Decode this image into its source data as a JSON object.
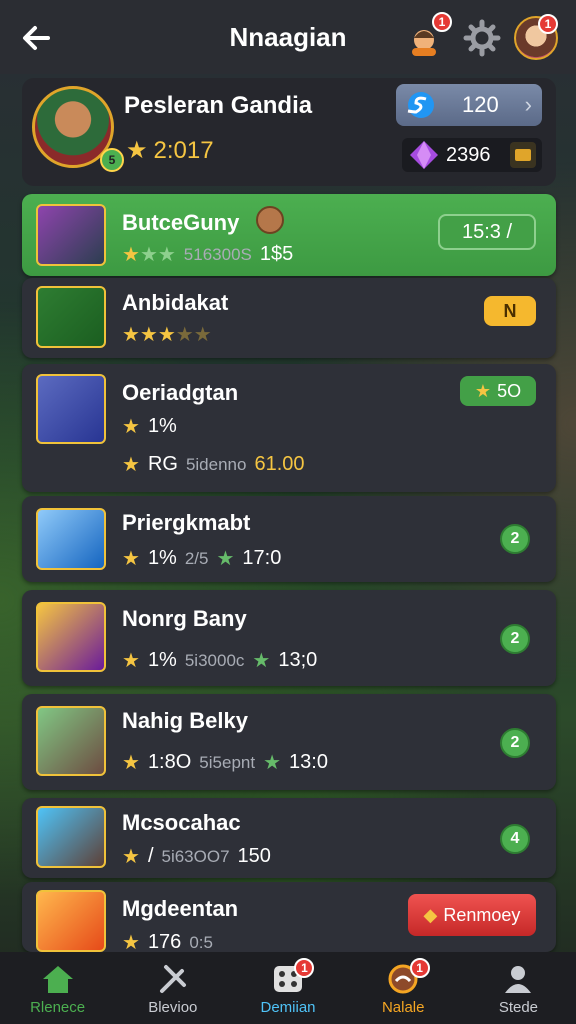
{
  "header": {
    "title": "Nnaagian",
    "notif_count_1": "1",
    "notif_count_2": "1"
  },
  "profile": {
    "name": "Pesleran Gandia",
    "score": "2:017",
    "coins": "120",
    "gems": "2396",
    "avatar_badge": "5"
  },
  "rows": [
    {
      "name": "ButceGuny",
      "stat": "516300S",
      "count": "1$5",
      "action": "15:3 /"
    },
    {
      "name": "Anbidakat",
      "action": "N"
    },
    {
      "name": "Oeriadgtan",
      "stars_text": "1%",
      "rating": "RG",
      "stat": "5idenno",
      "points": "61.00",
      "action": "5O"
    },
    {
      "name": "Priergkmabt",
      "stars_text": "1%",
      "stat": "2/5",
      "points": "17:0",
      "action": "2"
    },
    {
      "name": "Nonrg Bany",
      "stars_text": "1%",
      "stat": "5i3000c",
      "points": "13;0",
      "action": "2"
    },
    {
      "name": "Nahig Belky",
      "stars_text": "1:8O",
      "stat": "5i5epnt",
      "points": "13:0",
      "action": "2"
    },
    {
      "name": "Mcsocahac",
      "stars_text": "/",
      "stat": "5i63OO7",
      "points": "150",
      "action": "4"
    },
    {
      "name": "Mgdeentan",
      "stars_text": "176",
      "stat": "0:5",
      "action": "Renmoey"
    }
  ],
  "nav": [
    {
      "label": "Rlenece",
      "color": "#4caf50"
    },
    {
      "label": "Blevioo",
      "color": "#c9ccd2"
    },
    {
      "label": "Demiian",
      "color": "#4fc3f7",
      "badge": "1"
    },
    {
      "label": "Nalale",
      "color": "#f5a623",
      "badge": "1"
    },
    {
      "label": "Stede",
      "color": "#c9ccd2"
    }
  ]
}
